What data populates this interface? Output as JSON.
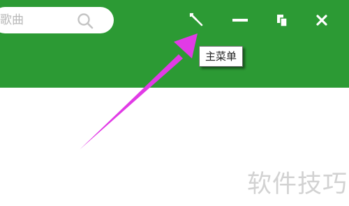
{
  "search": {
    "placeholder_text": "歌曲",
    "icon": "search-icon"
  },
  "window_controls": [
    {
      "name": "main-menu-button",
      "icon": "wrench-icon"
    },
    {
      "name": "minimize-button",
      "icon": "minimize-icon"
    },
    {
      "name": "restore-button",
      "icon": "restore-icon"
    },
    {
      "name": "close-button",
      "icon": "close-icon"
    }
  ],
  "tooltip": {
    "label": "主菜单"
  },
  "watermark": {
    "text": "软件技巧"
  },
  "colors": {
    "titlebar": "#2c9a34",
    "annotation_arrow": "#e13be6",
    "watermark": "#d2d2d2"
  }
}
